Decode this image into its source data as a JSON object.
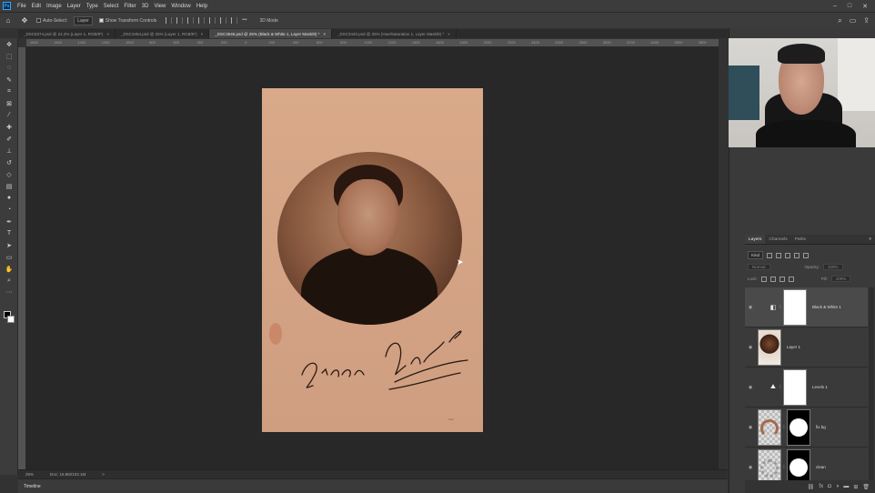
{
  "menu": {
    "logo": "Ps",
    "items": [
      "File",
      "Edit",
      "Image",
      "Layer",
      "Type",
      "Select",
      "Filter",
      "3D",
      "View",
      "Window",
      "Help"
    ],
    "window_controls": [
      "–",
      "□",
      "✕"
    ]
  },
  "options": {
    "auto_select_label": "Auto-Select:",
    "auto_select_value": "Layer",
    "show_transform_label": "Show Transform Controls",
    "mode_3d_label": "3D Mode"
  },
  "tabs": [
    {
      "label": "_DSC8374.psd @ 24.2% (Layer 1, RGB/8*)",
      "close": "×",
      "active": false
    },
    {
      "label": "_DSC3454.psd @ 25% (Layer 1, RGB/8*)",
      "close": "×",
      "active": false
    },
    {
      "label": "_DSC3645.psd @ 25% (Black & White 1, Layer Mask/8) *",
      "close": "×",
      "active": true
    },
    {
      "label": "_DSC3440.psd @ 25% (Hue/Saturation 1, Layer Mask/8) *",
      "close": "×",
      "active": false
    }
  ],
  "ruler_labels": [
    "1800",
    "1600",
    "1400",
    "1200",
    "1000",
    "800",
    "600",
    "400",
    "200",
    "0",
    "200",
    "400",
    "600",
    "800",
    "1000",
    "1200",
    "1400",
    "1600",
    "1800",
    "2000",
    "2200",
    "2400",
    "2600",
    "2800",
    "3000",
    "3200",
    "3400",
    "3600",
    "3800"
  ],
  "status": {
    "zoom": "25%",
    "doc": "Doc: 16.8M/103.1M",
    "arrow": ">"
  },
  "timeline_label": "Timeline",
  "layers_panel": {
    "tabs": [
      "Layers",
      "Channels",
      "Paths"
    ],
    "kind_label": "Kind",
    "blend_mode": "Normal",
    "opacity_label": "Opacity:",
    "opacity_value": "100%",
    "lock_label": "Lock:",
    "fill_label": "Fill:",
    "fill_value": "100%",
    "layers": [
      {
        "name": "Black & White 1",
        "selected": true,
        "type": "adjustment-bw"
      },
      {
        "name": "Layer 1",
        "selected": false,
        "type": "pixel"
      },
      {
        "name": "Levels 1",
        "selected": false,
        "type": "adjustment-levels"
      },
      {
        "name": "fix bg",
        "selected": false,
        "type": "masked"
      },
      {
        "name": "clean",
        "selected": false,
        "type": "masked"
      }
    ],
    "footer_icons": [
      "link-icon",
      "fx-icon",
      "mask-icon",
      "adjustment-icon",
      "group-icon",
      "new-layer-icon",
      "trash-icon"
    ]
  },
  "photo": {
    "signature_text": "Eleonora Santana",
    "stamp_text": "Foto"
  },
  "colors": {
    "accent": "#31a8ff",
    "canvas_bg": "#282828",
    "sepia": "#d6a687"
  }
}
